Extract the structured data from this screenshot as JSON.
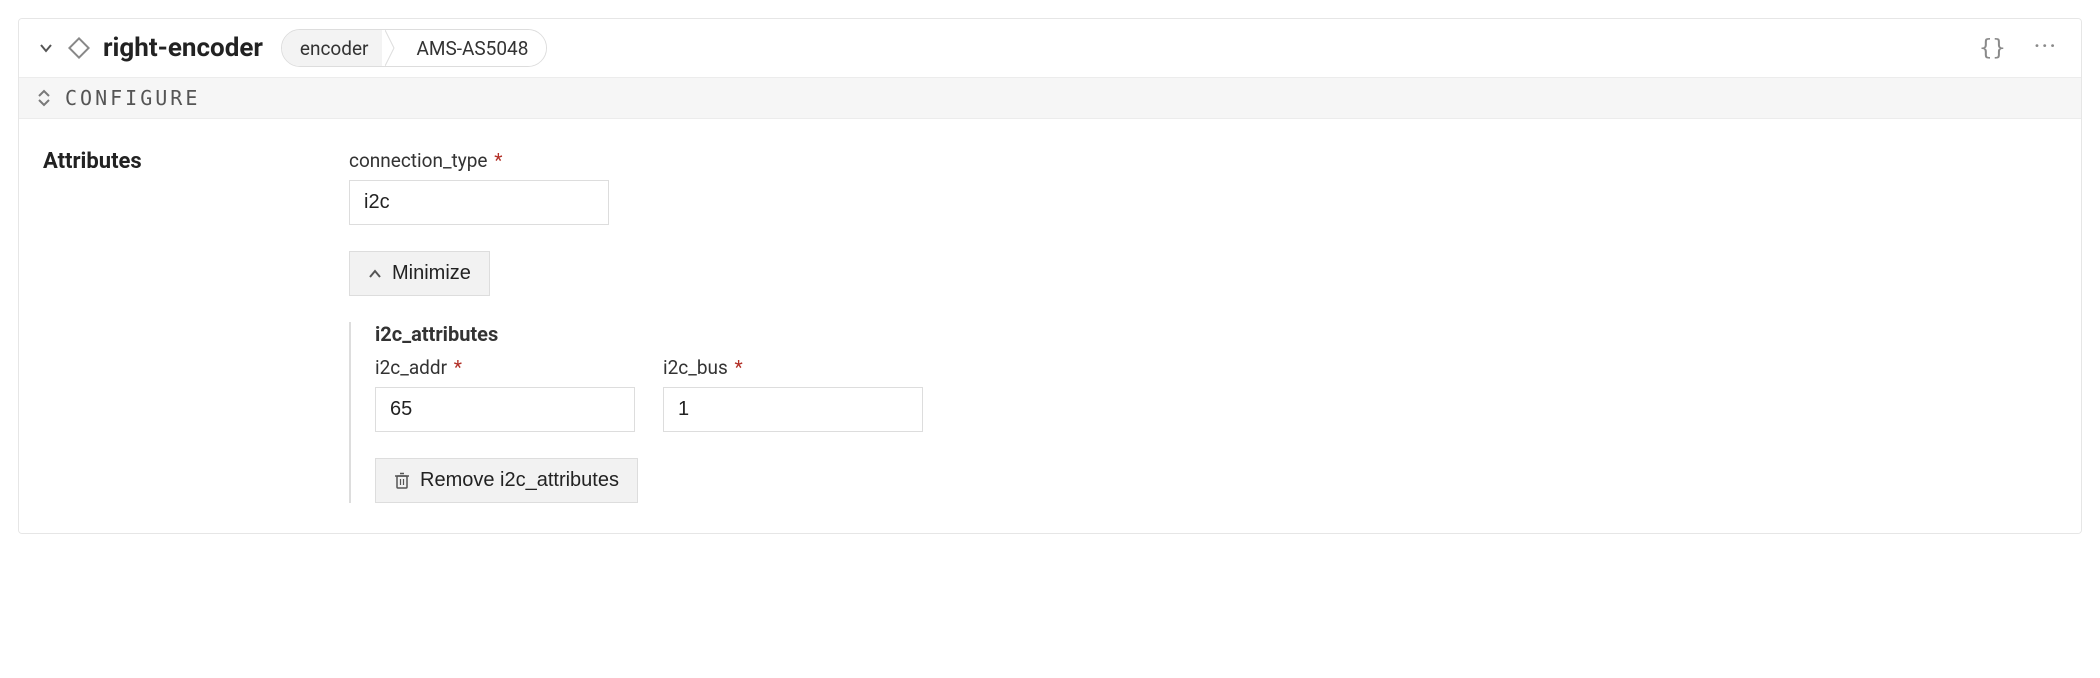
{
  "header": {
    "title": "right-encoder",
    "crumb1": "encoder",
    "crumb2": "AMS-AS5048",
    "braces": "{}",
    "dots": "···"
  },
  "configure": {
    "label": "CONFIGURE"
  },
  "attributes": {
    "section_title": "Attributes",
    "connection_type": {
      "label": "connection_type",
      "value": "i2c"
    },
    "minimize_label": "Minimize",
    "i2c_attributes": {
      "title": "i2c_attributes",
      "i2c_addr": {
        "label": "i2c_addr",
        "value": "65"
      },
      "i2c_bus": {
        "label": "i2c_bus",
        "value": "1"
      },
      "remove_label": "Remove i2c_attributes"
    }
  }
}
